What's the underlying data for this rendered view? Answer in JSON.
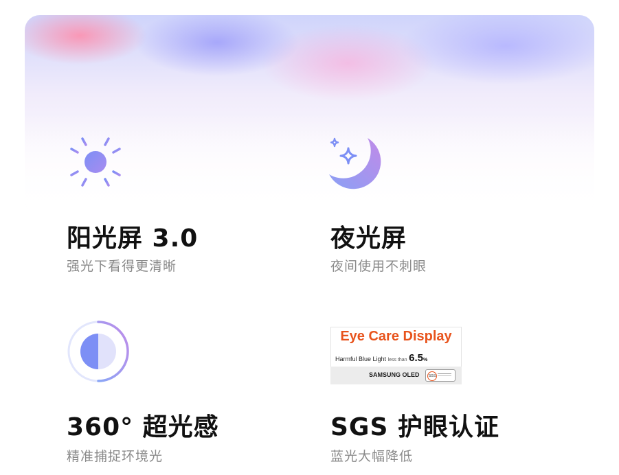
{
  "features": [
    {
      "title": "阳光屏 3.0",
      "subtitle": "强光下看得更清晰",
      "icon": "sun-icon"
    },
    {
      "title": "夜光屏",
      "subtitle": "夜间使用不刺眼",
      "icon": "moon-stars-icon"
    },
    {
      "title": "360° 超光感",
      "subtitle": "精准捕捉环境光",
      "icon": "light-sensor-icon"
    },
    {
      "title": "SGS 护眼认证",
      "subtitle": "蓝光大幅降低",
      "icon": "eye-care-certificate"
    }
  ],
  "certificate": {
    "brand": "Eye Care Display",
    "harmful_label": "Harmful Blue Light",
    "less_than": "less than",
    "value": "6.5",
    "unit": "%",
    "maker": "SAMSUNG OLED",
    "badge": "SGS"
  },
  "colors": {
    "title": "#111111",
    "subtitle": "#8a8a8a",
    "icon_blue": "#7d8ff5",
    "icon_purple": "#b48bee",
    "cert_orange": "#e8531c"
  }
}
